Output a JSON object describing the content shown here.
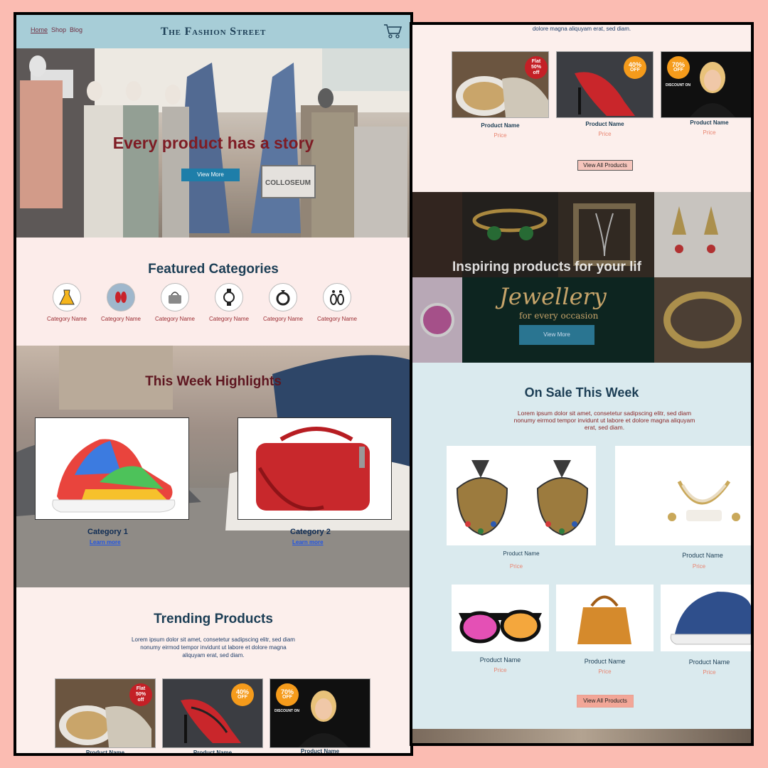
{
  "left": {
    "nav": {
      "links": [
        "Home",
        "Shop",
        "Blog"
      ],
      "brand": "The Fashion Street"
    },
    "hero": {
      "title": "Every product has a story",
      "button": "View More",
      "store_sign": "COLLOSEUM"
    },
    "featured": {
      "title": "Featured Categories",
      "categories": [
        "Category Name",
        "Category Name",
        "Category Name",
        "Category Name",
        "Category Name",
        "Category Name"
      ]
    },
    "highlights": {
      "title": "This Week Highlights",
      "cards": [
        {
          "category": "Category 1",
          "link": "Learn more"
        },
        {
          "category": "Category 2",
          "link": "Learn more"
        }
      ]
    },
    "trending": {
      "title": "Trending Products",
      "description": "Lorem ipsum dolor sit amet, consetetur sadipscing elitr, sed diam nonumy eirmod tempor invidunt ut labore et dolore magna aliquyam erat, sed diam.",
      "products": [
        {
          "name": "Product Name",
          "badge_top": "Flat",
          "badge_main": "50%",
          "badge_sub": "off"
        },
        {
          "name": "Product Name",
          "badge_main": "40%",
          "badge_sub": "OFF"
        },
        {
          "name": "Product Name",
          "badge_main": "70%",
          "badge_sub": "OFF",
          "caption": "DISCOUNT ON"
        }
      ]
    }
  },
  "right": {
    "top_text": "dolore magna aliquyam erat, sed diam.",
    "products": [
      {
        "name": "Product Name",
        "price": "Price",
        "badge_top": "Flat",
        "badge_main": "50%",
        "badge_sub": "off"
      },
      {
        "name": "Product Name",
        "price": "Price",
        "badge_main": "40%",
        "badge_sub": "OFF"
      },
      {
        "name": "Product Name",
        "price": "Price",
        "badge_main": "70%",
        "badge_sub": "OFF",
        "caption": "DISCOUNT ON"
      }
    ],
    "view_all_top": "View All Products",
    "jewellery": {
      "title": "Inspiring products for your lif",
      "script": "Jewellery",
      "subtitle": "for every occasion",
      "button": "View More"
    },
    "sale": {
      "title": "On Sale This Week",
      "description": "Lorem ipsum dolor sit amet, consetetur sadipscing elitr, sed diam nonumy eirmod tempor invidunt ut labore et dolore magna aliquyam erat, sed diam.",
      "products": [
        {
          "name": "Product Name",
          "price": "Price"
        },
        {
          "name": "Product Name",
          "price": "Price"
        },
        {
          "name": "Product Name",
          "price": "Price"
        },
        {
          "name": "Product Name",
          "price": "Price"
        },
        {
          "name": "Product Name",
          "price": "Price"
        }
      ],
      "view_all": "View All Products"
    }
  },
  "colors": {
    "background": "#fbbcb2",
    "nav": "#a7cdd7",
    "brand_text": "#1c3e55",
    "hero_title": "#7e1c24",
    "hero_button": "#1e7ea9",
    "category_text": "#9b2c32",
    "price": "#e98571",
    "sale_bg": "#daeaee"
  }
}
